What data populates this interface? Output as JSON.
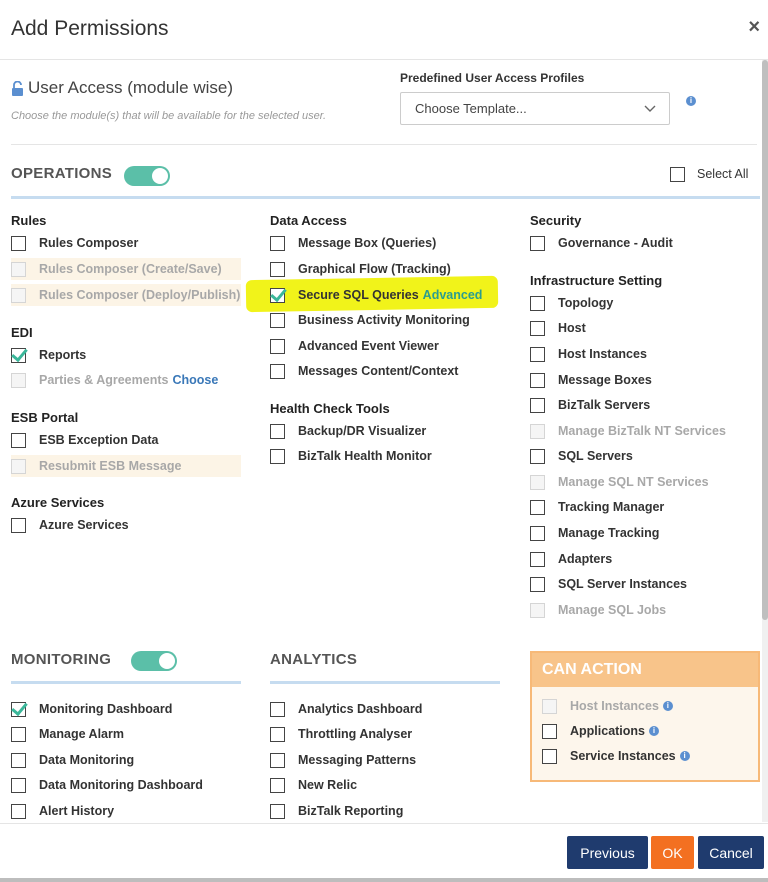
{
  "dialog": {
    "title": "Add Permissions",
    "close": "×"
  },
  "user_access": {
    "title": "User Access (module wise)",
    "subtitle": "Choose the module(s) that will be available for the selected user.",
    "profiles_label": "Predefined User Access Profiles",
    "template_value": "Choose Template..."
  },
  "operations": {
    "title": "OPERATIONS",
    "toggle_on": true,
    "select_all": "Select All"
  },
  "rules": {
    "title": "Rules",
    "items": [
      {
        "label": "Rules Composer",
        "checked": false,
        "disabled": false
      },
      {
        "label": "Rules Composer (Create/Save)",
        "checked": false,
        "disabled": true
      },
      {
        "label": "Rules Composer (Deploy/Publish)",
        "checked": false,
        "disabled": true
      }
    ]
  },
  "edi": {
    "title": "EDI",
    "items": [
      {
        "label": "Reports",
        "checked": true,
        "disabled": false
      },
      {
        "label": "Parties & Agreements",
        "checked": false,
        "disabled": true,
        "link": "Choose"
      }
    ]
  },
  "esb": {
    "title": "ESB Portal",
    "items": [
      {
        "label": "ESB Exception Data",
        "checked": false,
        "disabled": false
      },
      {
        "label": "Resubmit ESB Message",
        "checked": false,
        "disabled": true
      }
    ]
  },
  "azure": {
    "title": "Azure Services",
    "items": [
      {
        "label": "Azure Services",
        "checked": false,
        "disabled": false
      }
    ]
  },
  "data_access": {
    "title": "Data Access",
    "items": [
      {
        "label": "Message Box (Queries)",
        "checked": false
      },
      {
        "label": "Graphical Flow (Tracking)",
        "checked": false
      },
      {
        "label": "Secure SQL Queries",
        "checked": true,
        "extra": "Advanced"
      },
      {
        "label": "Business Activity Monitoring",
        "checked": false
      },
      {
        "label": "Advanced Event Viewer",
        "checked": false
      },
      {
        "label": "Messages Content/Context",
        "checked": false
      }
    ]
  },
  "health_check": {
    "title": "Health Check Tools",
    "items": [
      {
        "label": "Backup/DR Visualizer",
        "checked": false
      },
      {
        "label": "BizTalk Health Monitor",
        "checked": false
      }
    ]
  },
  "security": {
    "title": "Security",
    "items": [
      {
        "label": "Governance - Audit",
        "checked": false
      }
    ]
  },
  "infrastructure": {
    "title": "Infrastructure Setting",
    "items": [
      {
        "label": "Topology",
        "checked": false,
        "disabled": false
      },
      {
        "label": "Host",
        "checked": false,
        "disabled": false
      },
      {
        "label": "Host Instances",
        "checked": false,
        "disabled": false
      },
      {
        "label": "Message Boxes",
        "checked": false,
        "disabled": false
      },
      {
        "label": "BizTalk Servers",
        "checked": false,
        "disabled": false
      },
      {
        "label": "Manage BizTalk NT Services",
        "checked": false,
        "disabled": true
      },
      {
        "label": "SQL Servers",
        "checked": false,
        "disabled": false
      },
      {
        "label": "Manage SQL NT Services",
        "checked": false,
        "disabled": true
      },
      {
        "label": "Tracking Manager",
        "checked": false,
        "disabled": false
      },
      {
        "label": "Manage Tracking",
        "checked": false,
        "disabled": false
      },
      {
        "label": "Adapters",
        "checked": false,
        "disabled": false
      },
      {
        "label": "SQL Server Instances",
        "checked": false,
        "disabled": false
      },
      {
        "label": "Manage SQL Jobs",
        "checked": false,
        "disabled": true
      }
    ]
  },
  "monitoring": {
    "title": "MONITORING",
    "toggle_on": true,
    "items": [
      {
        "label": "Monitoring Dashboard",
        "checked": true
      },
      {
        "label": "Manage Alarm",
        "checked": false
      },
      {
        "label": "Data Monitoring",
        "checked": false
      },
      {
        "label": "Data Monitoring Dashboard",
        "checked": false
      },
      {
        "label": "Alert History",
        "checked": false
      }
    ]
  },
  "analytics": {
    "title": "ANALYTICS",
    "items": [
      {
        "label": "Analytics Dashboard",
        "checked": false
      },
      {
        "label": "Throttling Analyser",
        "checked": false
      },
      {
        "label": "Messaging Patterns",
        "checked": false
      },
      {
        "label": "New Relic",
        "checked": false
      },
      {
        "label": "BizTalk Reporting",
        "checked": false
      }
    ]
  },
  "can_action": {
    "title": "CAN ACTION",
    "items": [
      {
        "label": "Host Instances",
        "checked": false,
        "disabled": true
      },
      {
        "label": "Applications",
        "checked": false,
        "disabled": false
      },
      {
        "label": "Service Instances",
        "checked": false,
        "disabled": false
      }
    ]
  },
  "footer": {
    "previous": "Previous",
    "ok": "OK",
    "cancel": "Cancel"
  },
  "colors": {
    "primary": "#1f3b6e",
    "accent": "#f37021",
    "toggle": "#5bbfa8",
    "highlight": "#f1f31a"
  }
}
